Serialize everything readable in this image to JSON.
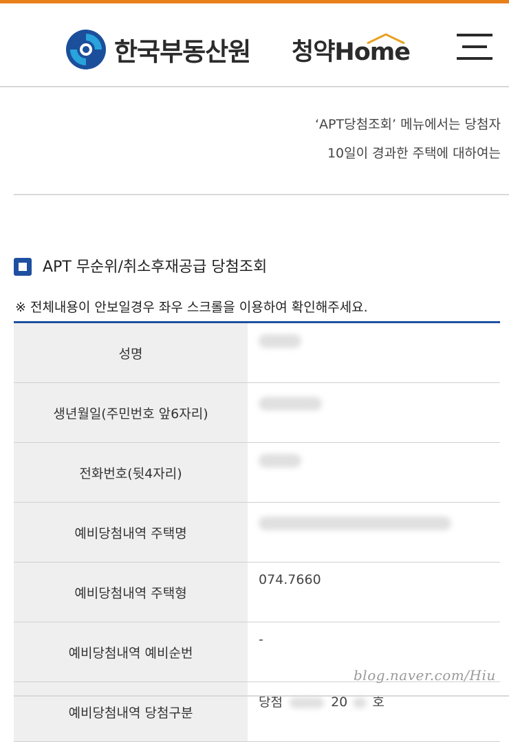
{
  "header": {
    "brand": "한국부동산원",
    "service": "청약Home",
    "menu_icon": "hamburger-icon",
    "accent_color": "#e8801a"
  },
  "notice": {
    "line1": "‘APT당첨조회’ 메뉴에서는 당첨자",
    "line2": "10일이 경과한 주택에 대하여는"
  },
  "section": {
    "title": "APT 무순위/취소후재공급 당첨조회",
    "scroll_note": "※ 전체내용이 안보일경우 좌우 스크롤을 이용하여 확인해주세요."
  },
  "table": {
    "rows": [
      {
        "label": "성명",
        "value": ""
      },
      {
        "label": "생년월일(주민번호 앞6자리)",
        "value": ""
      },
      {
        "label": "전화번호(뒷4자리)",
        "value": ""
      },
      {
        "label": "예비당첨내역 주택명",
        "value": ""
      },
      {
        "label": "예비당첨내역 주택형",
        "value": "074.7660"
      },
      {
        "label": "예비당첨내역 예비순번",
        "value": "-"
      },
      {
        "label": "예비당첨내역 당첨구분",
        "value_prefix": "당첨",
        "value_mid": "20",
        "value_suffix": "호"
      }
    ]
  },
  "watermark": "blog.naver.com/Hiu",
  "colors": {
    "primary_blue": "#1f4fa0",
    "label_bg": "#efefef"
  }
}
